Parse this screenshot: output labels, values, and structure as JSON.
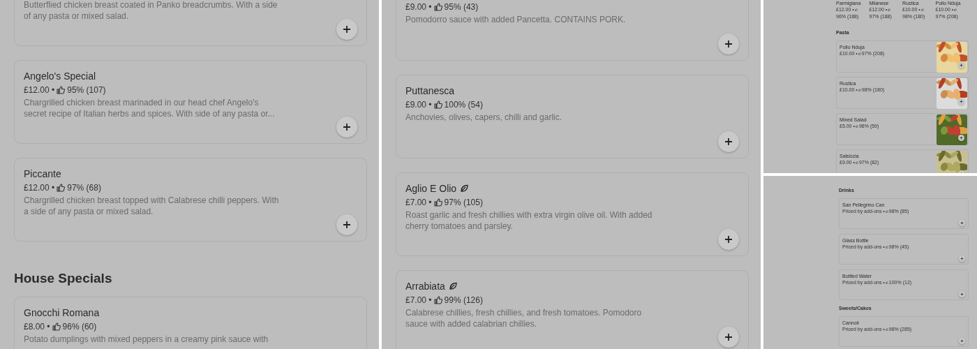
{
  "panels": [
    {
      "sections": [
        {
          "items": [
            {
              "description": "Butterflied chicken breast coated in Panko breadcrumbs. With a side of any pasta or mixed salad.",
              "has_photo": false
            },
            {
              "name": "Angelo's Special",
              "price": "£12.00 •",
              "rating": "95% (107)",
              "description": "Chargrilled chicken breast marinaded in our head chef Angelo's secret recipe of Italian herbs and spices. With side of any pasta or...",
              "veg": false,
              "has_photo": false
            },
            {
              "name": "Piccante",
              "price": "£12.00 •",
              "rating": "97% (68)",
              "description": "Chargrilled chicken breast topped with Calabrese chilli peppers. With a side of any pasta or mixed salad.",
              "veg": false,
              "has_photo": false
            }
          ]
        },
        {
          "heading": "House Specials",
          "items": [
            {
              "name": "Gnocchi Romana",
              "price": "£8.00 •",
              "rating": "96% (60)",
              "description": "Potato dumplings with mixed peppers in a creamy pink sauce with",
              "veg": false,
              "has_photo": false
            }
          ]
        }
      ]
    },
    {
      "sections": [
        {
          "items": [
            {
              "price": "£9.00 •",
              "rating": "95% (43)",
              "description": "Pomodorro sauce with added Pancetta. CONTAINS PORK.",
              "has_photo": false
            },
            {
              "name": "Puttanesca",
              "price": "£9.00 •",
              "rating": "100% (54)",
              "description": "Anchovies, olives, capers, chilli and garlic.",
              "veg": false,
              "has_photo": false
            },
            {
              "name": "Aglio E Olio",
              "price": "£7.00 •",
              "rating": "97% (105)",
              "description": "Roast garlic and fresh chillies with extra virgin olive oil. With added cherry tomatoes and parsley.",
              "veg": true,
              "has_photo": false
            },
            {
              "name": "Arrabiata",
              "price": "£7.00 •",
              "rating": "99% (126)",
              "description": "Calabrese chillies, fresh chillies, and fresh tomatoes. Pomodoro sauce with added calabrian chillies.",
              "veg": true,
              "has_photo": false
            }
          ]
        }
      ]
    },
    {
      "carousel": [
        {
          "name": "Parmigiana",
          "price": "£12.00 •",
          "rating": "96% (188)"
        },
        {
          "name": "Milanese",
          "price": "£12.00 •",
          "rating": "97% (188)"
        },
        {
          "name": "Rustica",
          "price": "£10.00 •",
          "rating": "98% (180)"
        },
        {
          "name": "Pollo Nduja",
          "price": "£10.00 •",
          "rating": "97% (208)"
        }
      ],
      "sections": [
        {
          "heading": "Pasta",
          "items": [
            {
              "name": "Pollo Nduja",
              "price": "£10.00 •",
              "rating": "97% (208)",
              "veg": false,
              "has_photo": true
            },
            {
              "name": "Rustica",
              "price": "£10.00 •",
              "rating": "98% (180)",
              "veg": false,
              "has_photo": true
            },
            {
              "name": "Mixed Salad",
              "price": "£5.00 •",
              "rating": "98% (59)",
              "veg": false,
              "has_photo": true
            },
            {
              "name": "Salsiccia",
              "price": "£9.00 •",
              "rating": "97% (82)",
              "veg": false,
              "has_photo": true
            }
          ]
        }
      ]
    },
    {
      "sections": [
        {
          "heading": "Drinks",
          "items": [
            {
              "name": "San Pellegrino Can",
              "price": "Priced by add-ons •",
              "rating": "98% (85)",
              "veg": false,
              "has_photo": false
            },
            {
              "name": "Glass Bottle",
              "price": "Priced by add-ons •",
              "rating": "98% (45)",
              "veg": false,
              "has_photo": false
            },
            {
              "name": "Bottled Water",
              "price": "Priced by add-ons •",
              "rating": "100% (12)",
              "veg": false,
              "has_photo": false
            }
          ]
        },
        {
          "heading": "Sweets/Cakes",
          "items": [
            {
              "name": "Cannoli",
              "price": "Priced by add-ons •",
              "rating": "98% (285)",
              "veg": false,
              "has_photo": false
            }
          ]
        }
      ]
    }
  ]
}
